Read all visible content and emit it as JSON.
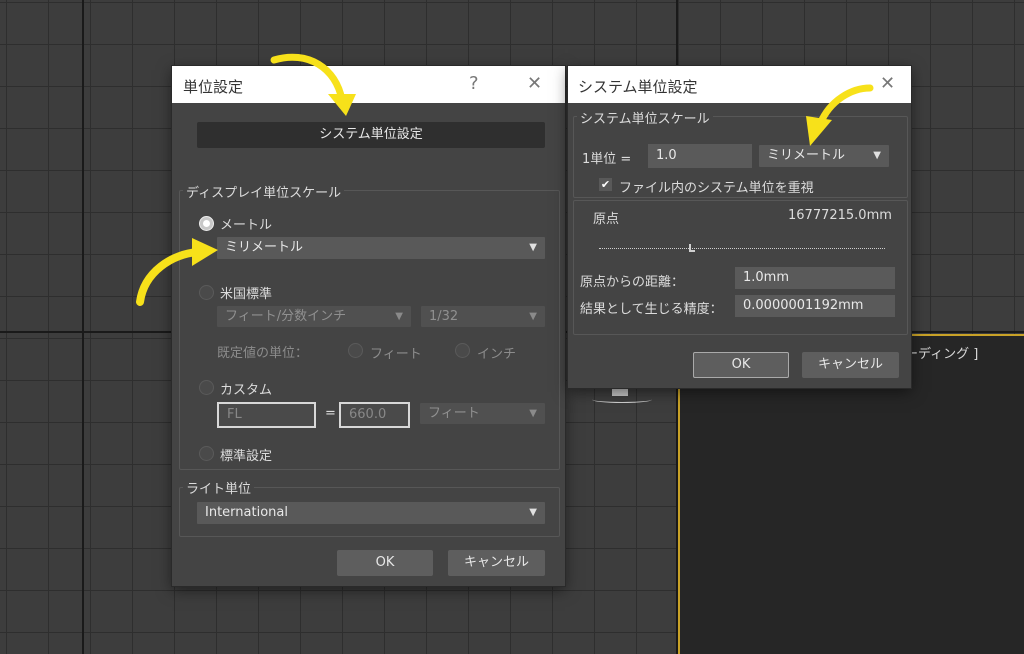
{
  "viewport": {
    "label": "ーディング ]"
  },
  "units_dialog": {
    "title": "単位設定",
    "help_icon": "?",
    "close_icon": "✕",
    "system_units_button": "システム単位設定",
    "display_scale": {
      "label": "ディスプレイ単位スケール",
      "metric_label": "メートル",
      "metric_value": "ミリメートル",
      "us_label": "米国標準",
      "us_value": "フィート/分数インチ",
      "us_fraction": "1/32",
      "default_units_label": "既定値の単位：",
      "feet_label": "フィート",
      "inch_label": "インチ",
      "custom_label": "カスタム",
      "custom_name": "FL",
      "equals": "=",
      "custom_value": "660.0",
      "custom_unit": "フィート",
      "generic_label": "標準設定"
    },
    "lighting": {
      "label": "ライト単位",
      "value": "International"
    },
    "ok": "OK",
    "cancel": "キャンセル"
  },
  "system_dialog": {
    "title": "システム単位設定",
    "close_icon": "✕",
    "scale_label": "システム単位スケール",
    "unit_label": "1単位 =",
    "unit_value": "1.0",
    "unit_type": "ミリメートル",
    "respect_label": "ファイル内のシステム単位を重視",
    "origin_label": "原点",
    "origin_value": "16777215.0mm",
    "distance_label": "原点からの距離：",
    "distance_value": "1.0mm",
    "precision_label": "結果として生じる精度：",
    "precision_value": "0.0000001192mm",
    "ok": "OK",
    "cancel": "キャンセル"
  },
  "colors": {
    "arrow": "#f7e11a",
    "background": "#3d3d3d",
    "dialog": "#444444"
  }
}
